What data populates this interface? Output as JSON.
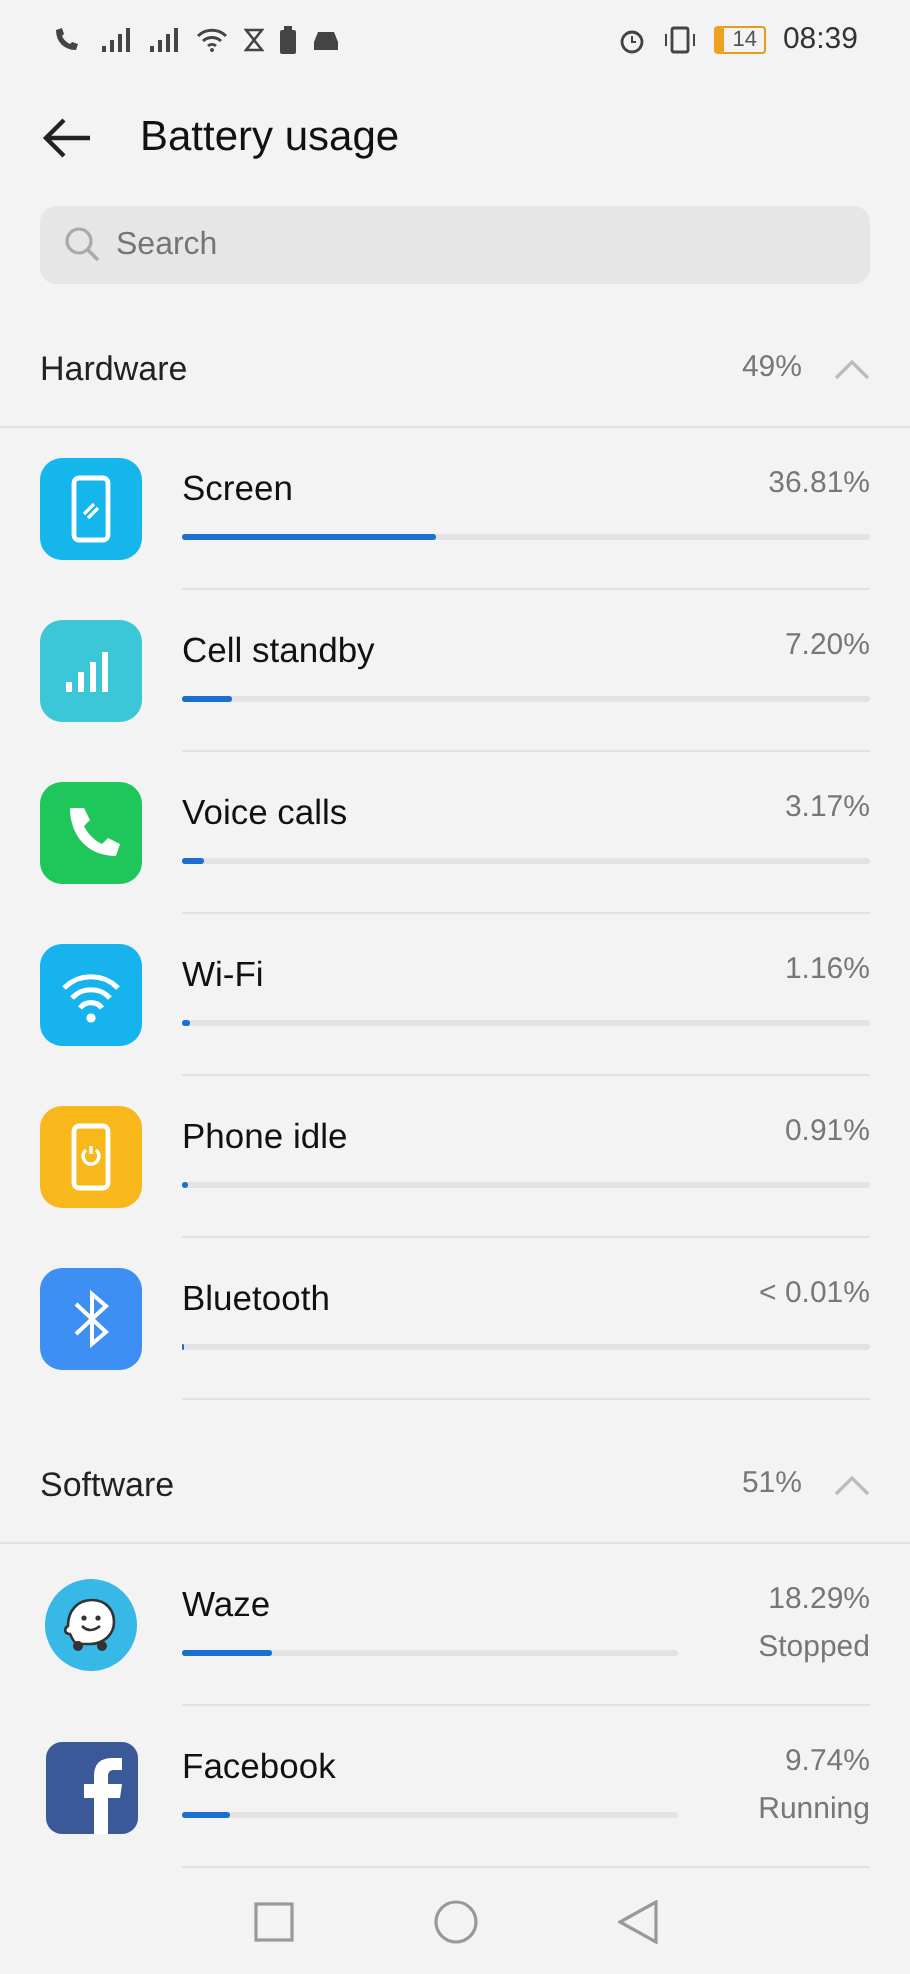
{
  "status_bar": {
    "battery": "14",
    "time": "08:39"
  },
  "header": {
    "title": "Battery usage"
  },
  "search": {
    "placeholder": "Search"
  },
  "sections": [
    {
      "title": "Hardware",
      "percent": "49%",
      "expanded": true,
      "items": [
        {
          "name": "Screen",
          "percent": "36.81%",
          "level": 0.37
        },
        {
          "name": "Cell standby",
          "percent": "7.20%",
          "level": 0.072
        },
        {
          "name": "Voice calls",
          "percent": "3.17%",
          "level": 0.032
        },
        {
          "name": "Wi-Fi",
          "percent": "1.16%",
          "level": 0.012
        },
        {
          "name": "Phone idle",
          "percent": "0.91%",
          "level": 0.009
        },
        {
          "name": "Bluetooth",
          "percent": "< 0.01%",
          "level": 0.003
        }
      ]
    },
    {
      "title": "Software",
      "percent": "51%",
      "expanded": true,
      "items": [
        {
          "name": "Waze",
          "percent": "18.29%",
          "level": 0.18,
          "status": "Stopped"
        },
        {
          "name": "Facebook",
          "percent": "9.74%",
          "level": 0.097,
          "status": "Running"
        }
      ]
    }
  ]
}
